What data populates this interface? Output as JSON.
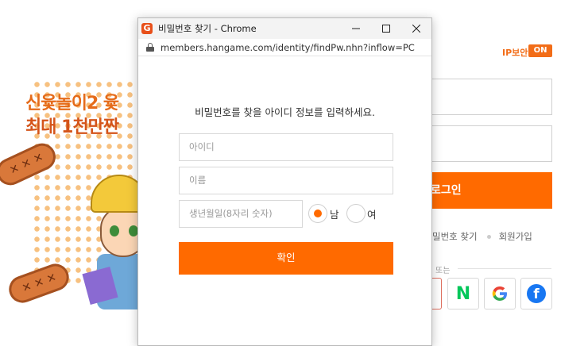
{
  "background_page": {
    "banner": {
      "line1": "신윷놀이2 윷",
      "line2": "최대 1천만짠"
    },
    "ip_security": {
      "label": "IP보안",
      "toggle": "ON"
    },
    "login_button": "로그인",
    "links": {
      "find_password": "밀번호 찾기",
      "signup": "회원가입"
    },
    "or_text": "또는",
    "social": {
      "naver_letter": "N",
      "google_letter": "G",
      "facebook_letter": "f"
    },
    "colors": {
      "accent": "#ff6a00",
      "naver": "#03c75a",
      "facebook": "#1877f2"
    }
  },
  "popup": {
    "title": "비밀번호 찾기 - Chrome",
    "app_icon_letter": "G",
    "url": "members.hangame.com/identity/findPw.nhn?inflow=PC",
    "instruction": "비밀번호를 찾을 아이디 정보를 입력하세요.",
    "fields": {
      "id_placeholder": "아이디",
      "name_placeholder": "이름",
      "birth_placeholder": "생년월일(8자리 숫자)"
    },
    "gender": {
      "male_label": "남",
      "female_label": "여",
      "selected": "male"
    },
    "confirm_button": "확인",
    "window_controls": {
      "minimize": "minimize-icon",
      "maximize": "maximize-icon",
      "close": "close-icon"
    }
  }
}
